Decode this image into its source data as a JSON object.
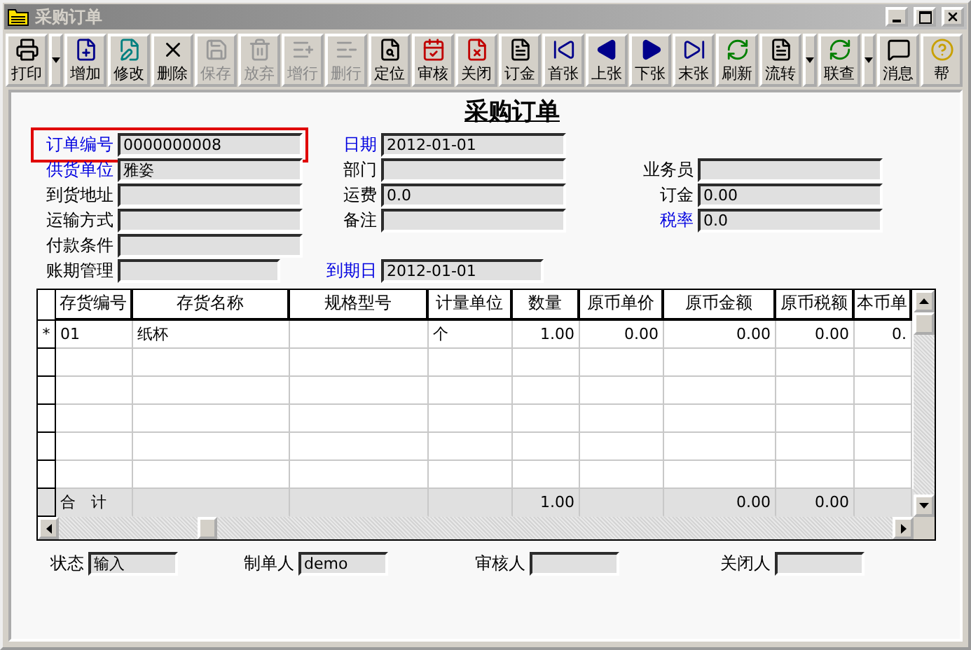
{
  "window": {
    "title": "采购订单"
  },
  "toolbar": [
    {
      "label": "打印",
      "disabled": false,
      "dropdown": true
    },
    {
      "label": "增加",
      "disabled": false,
      "dropdown": false
    },
    {
      "label": "修改",
      "disabled": false,
      "dropdown": false
    },
    {
      "label": "删除",
      "disabled": false,
      "dropdown": false
    },
    {
      "label": "保存",
      "disabled": true,
      "dropdown": false
    },
    {
      "label": "放弃",
      "disabled": true,
      "dropdown": false
    },
    {
      "label": "增行",
      "disabled": true,
      "dropdown": false
    },
    {
      "label": "删行",
      "disabled": true,
      "dropdown": false
    },
    {
      "label": "定位",
      "disabled": false,
      "dropdown": false
    },
    {
      "label": "审核",
      "disabled": false,
      "dropdown": false
    },
    {
      "label": "关闭",
      "disabled": false,
      "dropdown": false
    },
    {
      "label": "订金",
      "disabled": false,
      "dropdown": false
    },
    {
      "label": "首张",
      "disabled": false,
      "dropdown": false
    },
    {
      "label": "上张",
      "disabled": false,
      "dropdown": false
    },
    {
      "label": "下张",
      "disabled": false,
      "dropdown": false
    },
    {
      "label": "末张",
      "disabled": false,
      "dropdown": false
    },
    {
      "label": "刷新",
      "disabled": false,
      "dropdown": false
    },
    {
      "label": "流转",
      "disabled": false,
      "dropdown": true
    },
    {
      "label": "联查",
      "disabled": false,
      "dropdown": true
    },
    {
      "label": "消息",
      "disabled": false,
      "dropdown": false
    },
    {
      "label": "帮",
      "disabled": false,
      "dropdown": false
    }
  ],
  "form": {
    "title": "采购订单",
    "header_fields": [
      [
        {
          "label": "订单编号",
          "value": "0000000008",
          "link": true,
          "focused": true
        },
        {
          "label": "日期",
          "value": "2012-01-01",
          "link": true,
          "focused": false
        }
      ],
      [
        {
          "label": "供货单位",
          "value": "雅姿",
          "link": true,
          "focused": false
        },
        {
          "label": "部门",
          "link": false,
          "focused": false
        },
        {
          "label": "业务员",
          "link": false,
          "focused": false
        }
      ],
      [
        {
          "label": "到货地址",
          "link": false,
          "focused": false
        },
        {
          "label": "运费",
          "value": "0.0",
          "link": false,
          "focused": false
        },
        {
          "label": "订金",
          "value": "0.00",
          "link": false,
          "focused": false
        }
      ],
      [
        {
          "label": "运输方式",
          "link": false,
          "focused": false
        },
        {
          "label": "备注",
          "link": false,
          "focused": false
        },
        {
          "label": "税率",
          "value": "0.0",
          "link": true,
          "focused": false
        }
      ],
      [
        {
          "label": "付款条件",
          "link": false,
          "focused": false
        }
      ],
      [
        {
          "label": "账期管理",
          "link": false,
          "focused": false
        },
        {
          "label": "到期日",
          "value": "2012-01-01",
          "link": true,
          "focused": false
        }
      ]
    ],
    "table": {
      "columns": [
        "存货编号",
        "存货名称",
        "规格型号",
        "计量单位",
        "数量",
        "原币单价",
        "原币金额",
        "原币税额",
        "本币单"
      ],
      "rows": [
        {
          "marker": "*",
          "cells": [
            "01",
            "纸杯",
            "",
            "个",
            "1.00",
            "0.00",
            "0.00",
            "0.00",
            "0."
          ]
        },
        {
          "marker": "",
          "cells": [
            "",
            "",
            "",
            "",
            "",
            "",
            "",
            "",
            ""
          ]
        },
        {
          "marker": "",
          "cells": [
            "",
            "",
            "",
            "",
            "",
            "",
            "",
            "",
            ""
          ]
        },
        {
          "marker": "",
          "cells": [
            "",
            "",
            "",
            "",
            "",
            "",
            "",
            "",
            ""
          ]
        },
        {
          "marker": "",
          "cells": [
            "",
            "",
            "",
            "",
            "",
            "",
            "",
            "",
            ""
          ]
        },
        {
          "marker": "",
          "cells": [
            "",
            "",
            "",
            "",
            "",
            "",
            "",
            "",
            ""
          ]
        }
      ],
      "total": {
        "label": "合　计",
        "cells": [
          "",
          "",
          "",
          "",
          "1.00",
          "",
          "0.00",
          "0.00",
          ""
        ]
      }
    },
    "footer_fields": [
      {
        "label": "状态",
        "value": "输入"
      },
      {
        "label": "制单人",
        "value": "demo"
      },
      {
        "label": "审核人"
      },
      {
        "label": "关闭人"
      }
    ]
  }
}
